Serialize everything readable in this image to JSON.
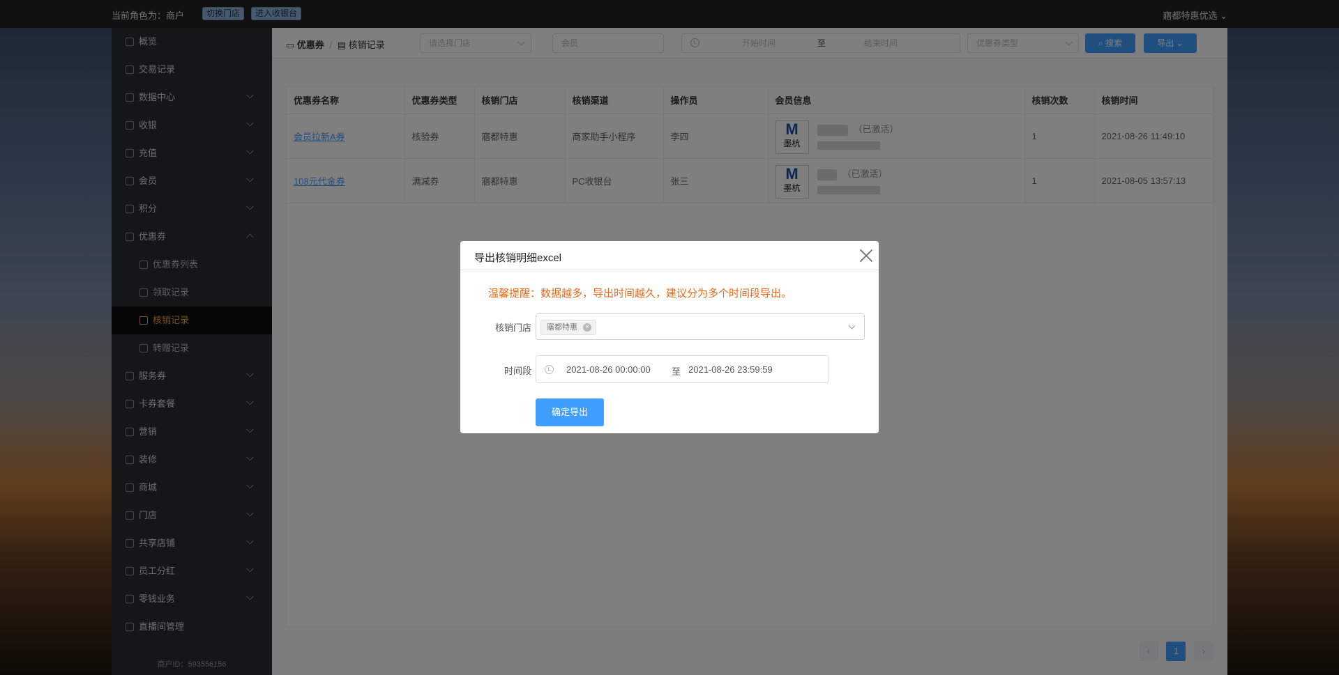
{
  "topbar": {
    "role_text": "当前角色为：商户",
    "switch_store": "切换门店",
    "enter_cashier": "进入收银台",
    "store_name": "寤都特惠优选"
  },
  "sidebar": {
    "items": [
      {
        "label": "概览",
        "chevron": false
      },
      {
        "label": "交易记录",
        "chevron": false
      },
      {
        "label": "数据中心",
        "chevron": true
      },
      {
        "label": "收银",
        "chevron": true
      },
      {
        "label": "充值",
        "chevron": true
      },
      {
        "label": "会员",
        "chevron": true
      },
      {
        "label": "积分",
        "chevron": true
      },
      {
        "label": "优惠券",
        "chevron": true,
        "expanded": true
      },
      {
        "label": "优惠券列表",
        "sub": true
      },
      {
        "label": "领取记录",
        "sub": true
      },
      {
        "label": "核销记录",
        "sub": true,
        "active": true
      },
      {
        "label": "转赠记录",
        "sub": true
      },
      {
        "label": "服务券",
        "chevron": true
      },
      {
        "label": "卡券套餐",
        "chevron": true
      },
      {
        "label": "营销",
        "chevron": true
      },
      {
        "label": "装修",
        "chevron": true
      },
      {
        "label": "商城",
        "chevron": true
      },
      {
        "label": "门店",
        "chevron": true
      },
      {
        "label": "共享店铺",
        "chevron": true
      },
      {
        "label": "员工分红",
        "chevron": true
      },
      {
        "label": "零钱业务",
        "chevron": true
      },
      {
        "label": "直播间管理",
        "chevron": false
      }
    ],
    "merchant_id": "商户ID：593556156"
  },
  "breadcrumb": {
    "root": "优惠券",
    "current": "核销记录"
  },
  "filters": {
    "store_placeholder": "请选择门店",
    "member_placeholder": "会员",
    "start_placeholder": "开始时间",
    "to": "至",
    "end_placeholder": "结束时间",
    "type_placeholder": "优惠券类型",
    "search": "搜索",
    "export": "导出"
  },
  "table": {
    "headers": [
      "优惠券名称",
      "优惠券类型",
      "核销门店",
      "核销渠道",
      "操作员",
      "会员信息",
      "核销次数",
      "核销时间"
    ],
    "rows": [
      {
        "name": "会员拉新A券",
        "type": "核验券",
        "store": "寤都特惠",
        "channel": "商家助手小程序",
        "operator": "李四",
        "member_status": "（已激活）",
        "count": "1",
        "time": "2021-08-26 11:49:10"
      },
      {
        "name": "108元代金券",
        "type": "满减券",
        "store": "寤都特惠",
        "channel": "PC收银台",
        "operator": "张三",
        "member_status": "（已激活）",
        "count": "1",
        "time": "2021-08-05 13:57:13"
      }
    ],
    "logo_text": "墨杭"
  },
  "pagination": {
    "prev": "‹",
    "current": "1",
    "next": "›"
  },
  "dialog": {
    "title": "导出核销明细excel",
    "tip": "温馨提醒：数据越多，导出时间越久，建议分为多个时间段导出。",
    "store_label": "核销门店",
    "store_tag": "寤都特惠",
    "time_label": "时间段",
    "start": "2021-08-26 00:00:00",
    "to": "至",
    "end": "2021-08-26 23:59:59",
    "confirm": "确定导出"
  }
}
